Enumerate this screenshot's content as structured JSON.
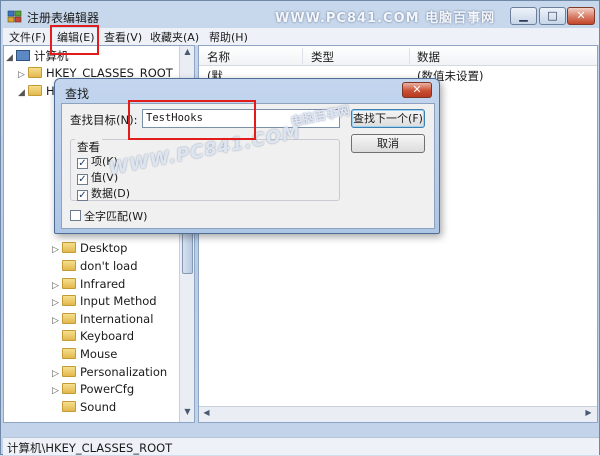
{
  "window": {
    "title": "注册表编辑器",
    "watermark": "WWW.PC841.COM 电脑百事网",
    "buttons": {
      "minimize": "▁",
      "maximize": "□",
      "close": "✕"
    }
  },
  "menu": {
    "items": [
      {
        "label": "文件(F)"
      },
      {
        "label": "编辑(E)"
      },
      {
        "label": "查看(V)"
      },
      {
        "label": "收藏夹(A)"
      },
      {
        "label": "帮助(H)"
      }
    ]
  },
  "tree": {
    "root": "计算机",
    "top_items": [
      {
        "label": "HKEY_CLASSES_ROOT"
      },
      {
        "label": "HKEY"
      }
    ],
    "items": [
      {
        "label": "Desktop",
        "expandable": true
      },
      {
        "label": "don't load",
        "expandable": false
      },
      {
        "label": "Infrared",
        "expandable": true
      },
      {
        "label": "Input Method",
        "expandable": true
      },
      {
        "label": "International",
        "expandable": true
      },
      {
        "label": "Keyboard",
        "expandable": false
      },
      {
        "label": "Mouse",
        "expandable": false
      },
      {
        "label": "Personalization",
        "expandable": true
      },
      {
        "label": "PowerCfg",
        "expandable": true
      },
      {
        "label": "Sound",
        "expandable": false
      }
    ]
  },
  "list": {
    "columns": [
      "名称",
      "类型",
      "数据"
    ],
    "rows": [
      {
        "name": "(默",
        "data": "(数值未设置)"
      }
    ]
  },
  "status": {
    "path": "计算机\\HKEY_CLASSES_ROOT"
  },
  "find_dialog": {
    "title": "查找",
    "close": "✕",
    "target_label": "查找目标(N):",
    "target_value": "TestHooks",
    "find_next": "查找下一个(F)",
    "cancel": "取消",
    "look_at": "查看",
    "options": [
      {
        "label": "项(K)",
        "checked": true
      },
      {
        "label": "值(V)",
        "checked": true
      },
      {
        "label": "数据(D)",
        "checked": true
      }
    ],
    "match_whole": {
      "label": "全字匹配(W)",
      "checked": false
    },
    "watermark_main": "WWW.PC841.COM",
    "watermark_cn": "电脑百事网"
  }
}
